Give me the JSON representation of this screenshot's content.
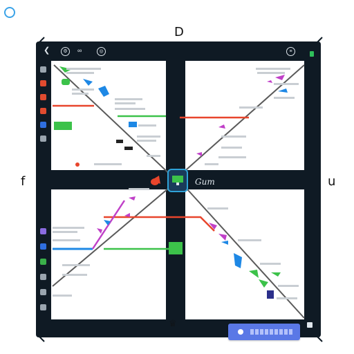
{
  "app": {
    "logo_text": "",
    "compass": {
      "north": "D",
      "west": "f",
      "east": "u"
    },
    "hub_label": "Gum"
  },
  "toolbar": {
    "left_icons": [
      "back-arrow-icon",
      "settings-icon",
      "link-icon",
      "globe-icon"
    ],
    "right_icon": "menu-icon"
  },
  "sidebar": {
    "upper_icons": [
      {
        "icon": "list-icon",
        "color": "#9aa5af"
      },
      {
        "icon": "flag-icon",
        "color": "#e04b2f"
      },
      {
        "icon": "flag-icon",
        "color": "#e04b2f"
      },
      {
        "icon": "doc-icon",
        "color": "#e04b2f"
      },
      {
        "icon": "folder-icon",
        "color": "#2f6fe0"
      },
      {
        "icon": "gear-icon",
        "color": "#9aa5af"
      }
    ],
    "lower_icons": [
      {
        "icon": "bolt-icon",
        "color": "#8a6be0"
      },
      {
        "icon": "layers-icon",
        "color": "#2f6fe0"
      },
      {
        "icon": "leaf-icon",
        "color": "#3ab04a"
      },
      {
        "icon": "link-icon",
        "color": "#9aa5af"
      },
      {
        "icon": "bell-icon",
        "color": "#9aa5af"
      },
      {
        "icon": "info-icon",
        "color": "#9aa5af"
      }
    ]
  },
  "colors": {
    "frame": "#0f1a24",
    "red": "#e8452c",
    "green": "#3cc24a",
    "blue": "#1e88e5",
    "magenta": "#c040c8",
    "gray_line": "#5a5a5a",
    "search": "#5a78e6"
  }
}
